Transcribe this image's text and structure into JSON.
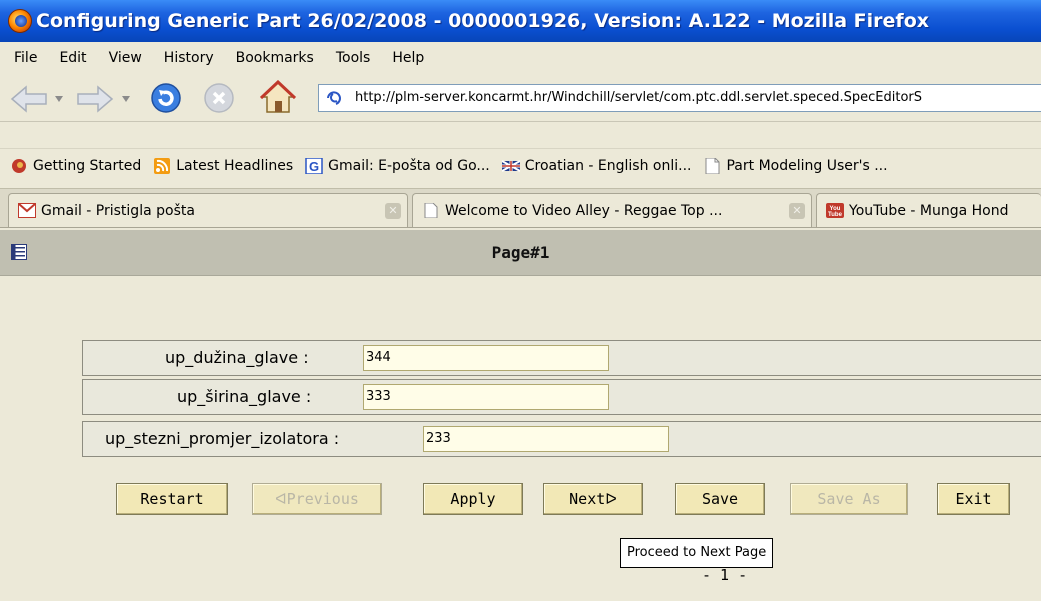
{
  "window": {
    "title": "Configuring Generic Part 26/02/2008 - 0000001926, Version: A.122 - Mozilla Firefox"
  },
  "menu": {
    "items": [
      "File",
      "Edit",
      "View",
      "History",
      "Bookmarks",
      "Tools",
      "Help"
    ]
  },
  "nav": {
    "url": "http://plm-server.koncarmt.hr/Windchill/servlet/com.ptc.ddl.servlet.speced.SpecEditorS"
  },
  "bookmarks": [
    {
      "label": "Getting Started",
      "icon": "firefox-icon"
    },
    {
      "label": "Latest Headlines",
      "icon": "rss-icon"
    },
    {
      "label": "Gmail: E-pošta od Go...",
      "icon": "google-icon"
    },
    {
      "label": "Croatian - English onli...",
      "icon": "uk-flag-icon"
    },
    {
      "label": "Part Modeling User's ...",
      "icon": "page-icon"
    }
  ],
  "tabs": [
    {
      "label": "Gmail - Pristigla pošta",
      "icon": "gmail-icon"
    },
    {
      "label": "Welcome to Video Alley - Reggae Top ...",
      "icon": "page-icon"
    },
    {
      "label": "YouTube - Munga Hond",
      "icon": "youtube-icon"
    }
  ],
  "page": {
    "title": "Page#1",
    "fields": [
      {
        "label": "up_dužina_glave :",
        "value": "344"
      },
      {
        "label": "up_širina_glave :",
        "value": "333"
      },
      {
        "label": "up_stezni_promjer_izolatora :",
        "value": "233"
      }
    ],
    "buttons": {
      "restart": "Restart",
      "previous": "Previous",
      "apply": "Apply",
      "next": "Next",
      "save": "Save",
      "save_as": "Save As",
      "exit": "Exit"
    },
    "tooltip": "Proceed to Next Page",
    "page_number": "- 1 -"
  }
}
